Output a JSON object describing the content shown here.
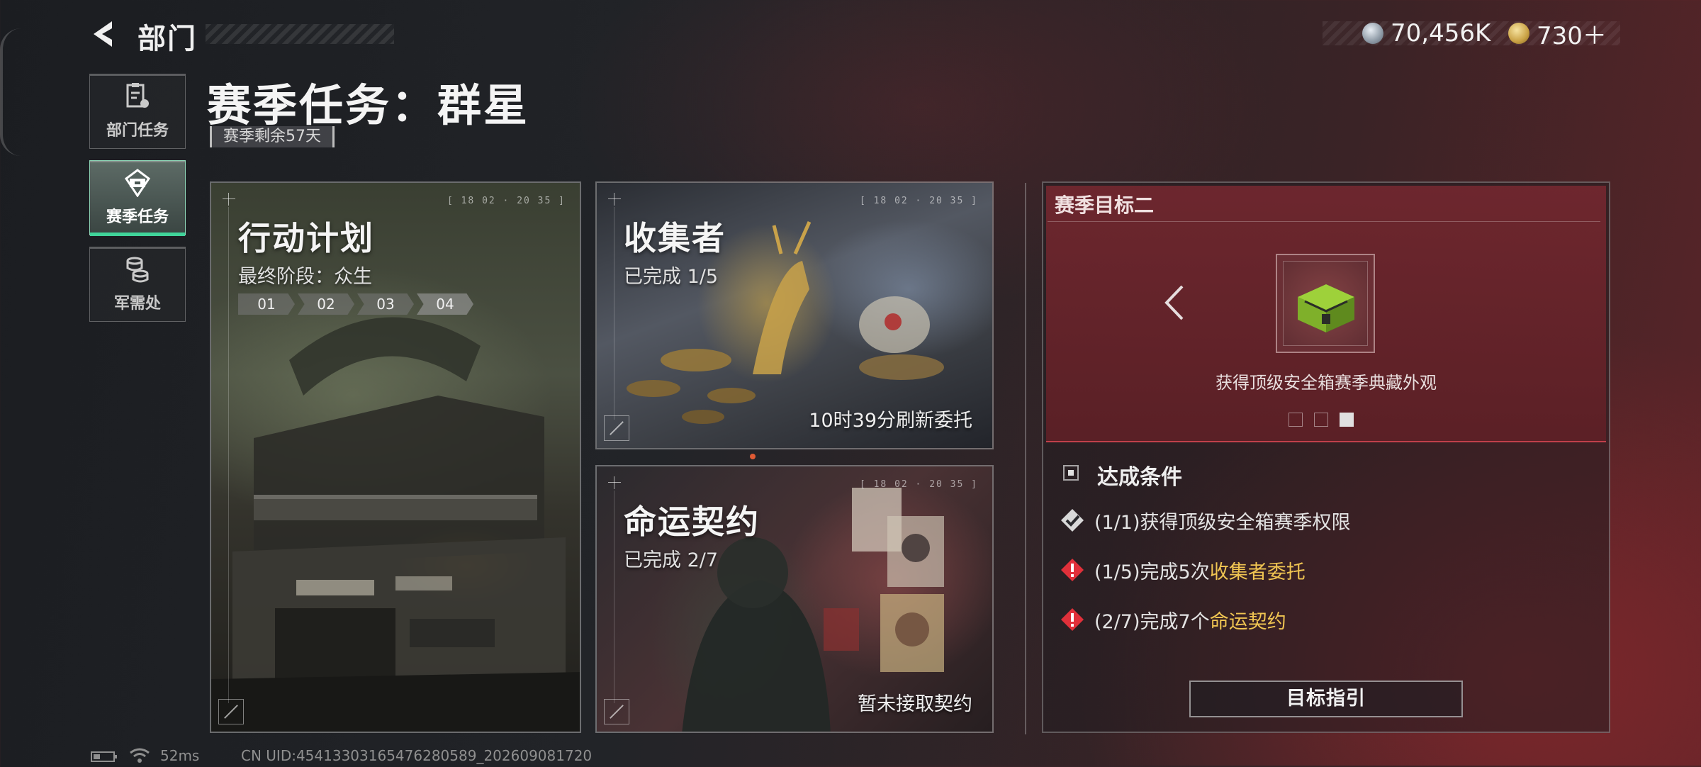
{
  "header": {
    "title": "部门"
  },
  "currency": {
    "silver": {
      "icon": "silver-coin-icon",
      "value": "70,456K"
    },
    "gold": {
      "icon": "gold-coin-icon",
      "value": "730＋"
    }
  },
  "sidebar": {
    "items": [
      {
        "label": "部门任务",
        "icon": "department-task-icon",
        "active": false
      },
      {
        "label": "赛季任务",
        "icon": "season-task-icon",
        "active": true
      },
      {
        "label": "军需处",
        "icon": "supply-icon",
        "active": false
      }
    ]
  },
  "page": {
    "title": "赛季任务：群星",
    "season_remaining": "赛季剩余57天"
  },
  "cards": {
    "plan": {
      "title": "行动计划",
      "subtitle": "最终阶段：众生",
      "stages": [
        "01",
        "02",
        "03",
        "04"
      ]
    },
    "collector": {
      "title": "收集者",
      "progress": "已完成 1/5",
      "footer": "10时39分刷新委托"
    },
    "fate": {
      "title": "命运契约",
      "progress": "已完成 2/7",
      "footer": "暂未接取契约"
    }
  },
  "goal": {
    "title": "赛季目标二",
    "reward_caption": "获得顶级安全箱赛季典藏外观",
    "page_index": 3,
    "page_count": 3,
    "conditions_title": "达成条件",
    "conditions": [
      {
        "prefix": "(1/1)获得顶级安全箱赛季权限",
        "highlight": "",
        "status": "done"
      },
      {
        "prefix": "(1/5)完成5次",
        "highlight": "收集者委托",
        "status": "incomplete"
      },
      {
        "prefix": "(2/7)完成7个",
        "highlight": "命运契约",
        "status": "incomplete"
      }
    ],
    "guide_button": "目标指引"
  },
  "status_bar": {
    "latency": "52ms",
    "uid": "CN UID:454133031654762805​89_202609081720"
  },
  "colors": {
    "accent_green": "#40d49a",
    "highlight_yellow": "#f0c552",
    "warning_red": "#e0303a"
  }
}
